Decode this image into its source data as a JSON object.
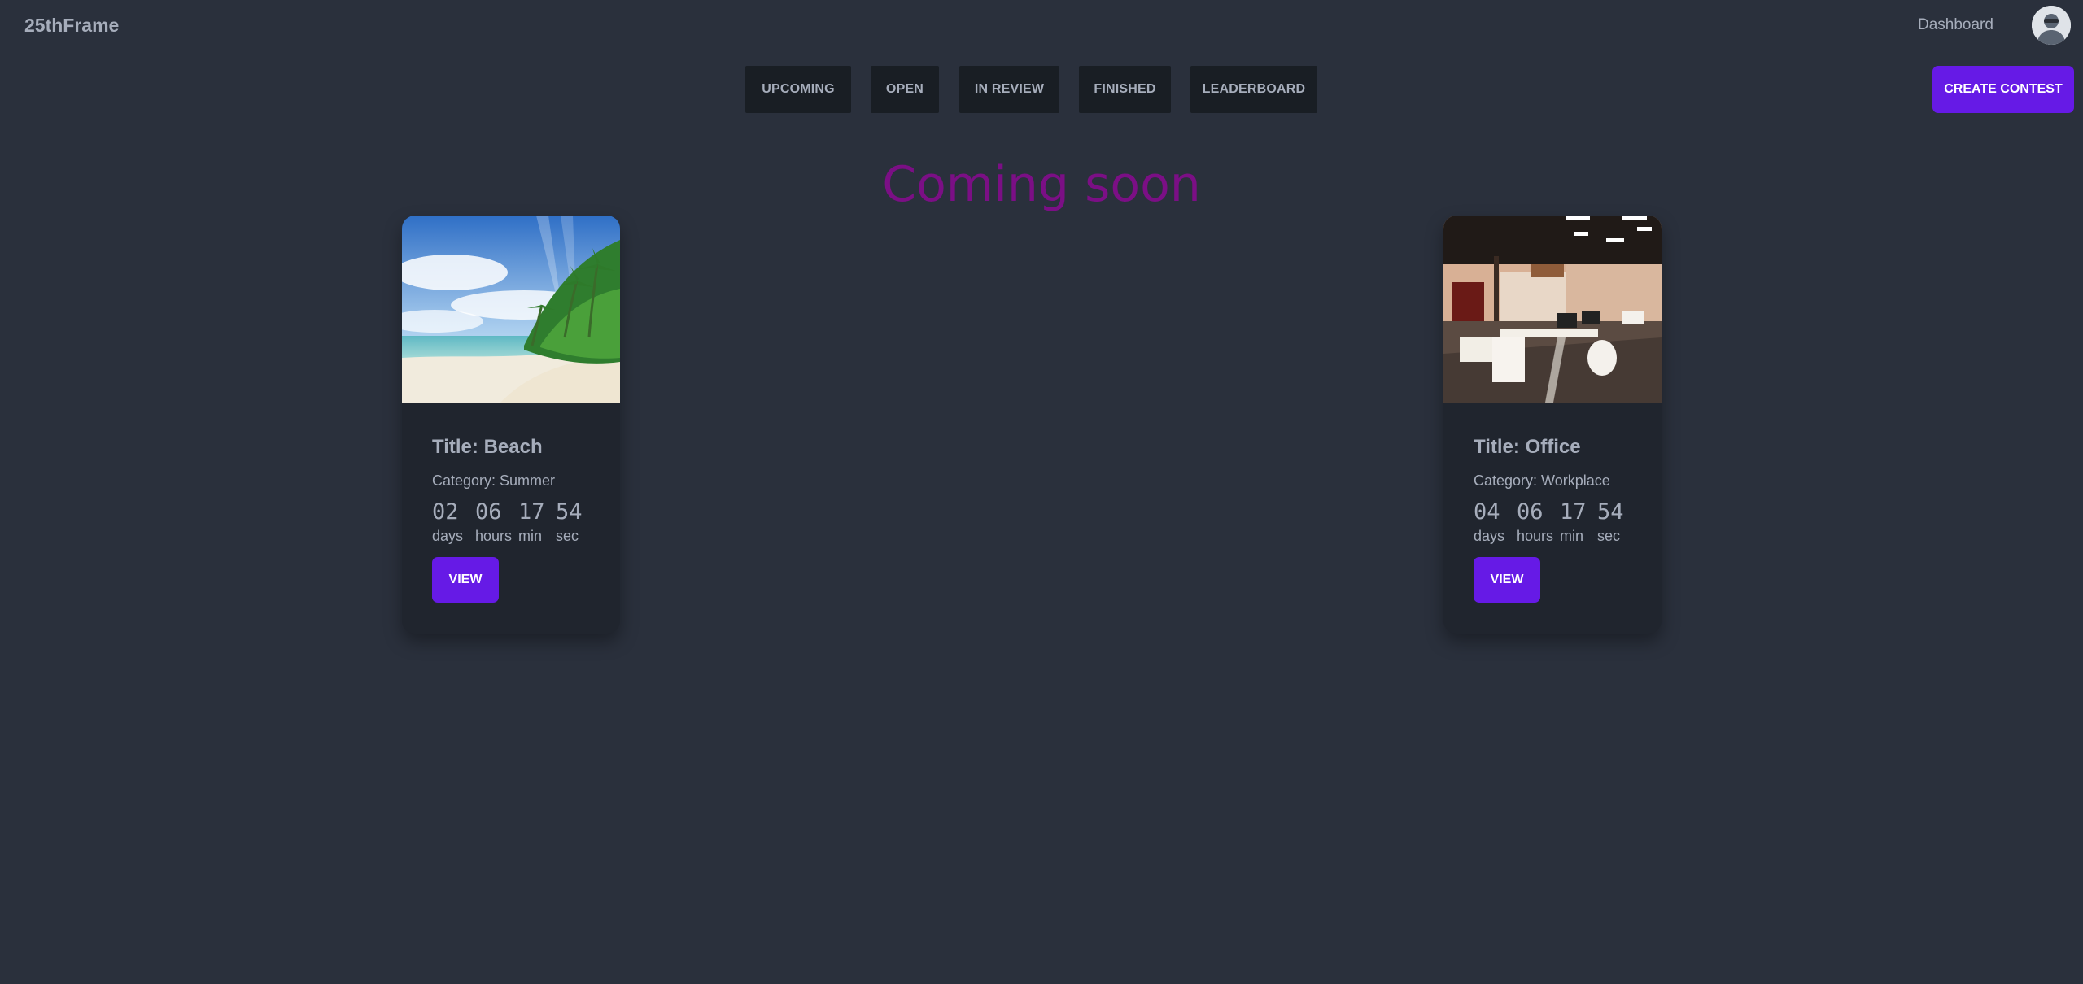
{
  "header": {
    "brand": "25thFrame",
    "nav_dashboard": "Dashboard"
  },
  "tabs": [
    {
      "label": "UPCOMING"
    },
    {
      "label": "OPEN"
    },
    {
      "label": "IN REVIEW"
    },
    {
      "label": "FINISHED"
    },
    {
      "label": "LEADERBOARD"
    }
  ],
  "create_contest_label": "CREATE CONTEST",
  "heading": "Coming soon",
  "cards": [
    {
      "title": "Title: Beach",
      "category": "Category: Summer",
      "countdown": {
        "days": "02",
        "hours": "06",
        "min": "17",
        "sec": "54",
        "days_label": "days",
        "hours_label": "hours",
        "min_label": "min",
        "sec_label": "sec"
      },
      "view_label": "VIEW",
      "image_icon": "beach-image"
    },
    {
      "title": "Title: Office",
      "category": "Category: Workplace",
      "countdown": {
        "days": "04",
        "hours": "06",
        "min": "17",
        "sec": "54",
        "days_label": "days",
        "hours_label": "hours",
        "min_label": "min",
        "sec_label": "sec"
      },
      "view_label": "VIEW",
      "image_icon": "office-image"
    }
  ],
  "colors": {
    "background": "#2a303c",
    "tab_bg": "#191e24",
    "primary": "#661ae6",
    "heading": "#7b0f85",
    "card_bg": "#20252e",
    "text": "#a6adbb"
  }
}
